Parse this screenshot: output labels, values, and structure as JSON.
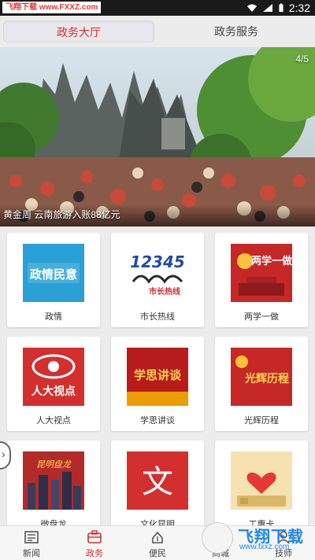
{
  "status_bar": {
    "watermark_left": "飞翔下载",
    "watermark_right": "www.FXXZ.com",
    "time": "2:32",
    "icons": [
      "wifi-icon",
      "signal-icon",
      "battery-icon"
    ]
  },
  "tabs": [
    {
      "label": "政务大厅",
      "active": true
    },
    {
      "label": "政务服务",
      "active": false
    }
  ],
  "banner": {
    "counter": "4/5",
    "caption": "黄金周 云南旅游入账88亿元"
  },
  "grid": [
    {
      "label": "政情",
      "art_text": "政情民意"
    },
    {
      "label": "市长热线",
      "art_text": "12345",
      "art_sub": "市长热线"
    },
    {
      "label": "两学一做",
      "art_text": "两学一做"
    },
    {
      "label": "人大视点",
      "art_text": "人大视点"
    },
    {
      "label": "学思讲谈",
      "art_text": "学思讲谈"
    },
    {
      "label": "光辉历程",
      "art_text": "光辉历程"
    },
    {
      "label": "微盘龙",
      "art_text": "昆明盘龙"
    },
    {
      "label": "文化昆明",
      "art_text": "文"
    },
    {
      "label": "工惠卡",
      "art_text": ""
    }
  ],
  "bottom_nav": [
    {
      "label": "新闻",
      "icon": "news-icon",
      "active": false
    },
    {
      "label": "政务",
      "icon": "government-icon",
      "active": true
    },
    {
      "label": "便民",
      "icon": "convenience-icon",
      "active": false
    },
    {
      "label": "商城",
      "icon": "mall-icon",
      "active": false
    },
    {
      "label": "技师",
      "icon": "technician-icon",
      "active": false
    }
  ],
  "watermark": {
    "title": "飞翔下载",
    "url": "www.fxxz.com"
  },
  "colors": {
    "accent": "#d32f2f",
    "background": "#ececec"
  }
}
